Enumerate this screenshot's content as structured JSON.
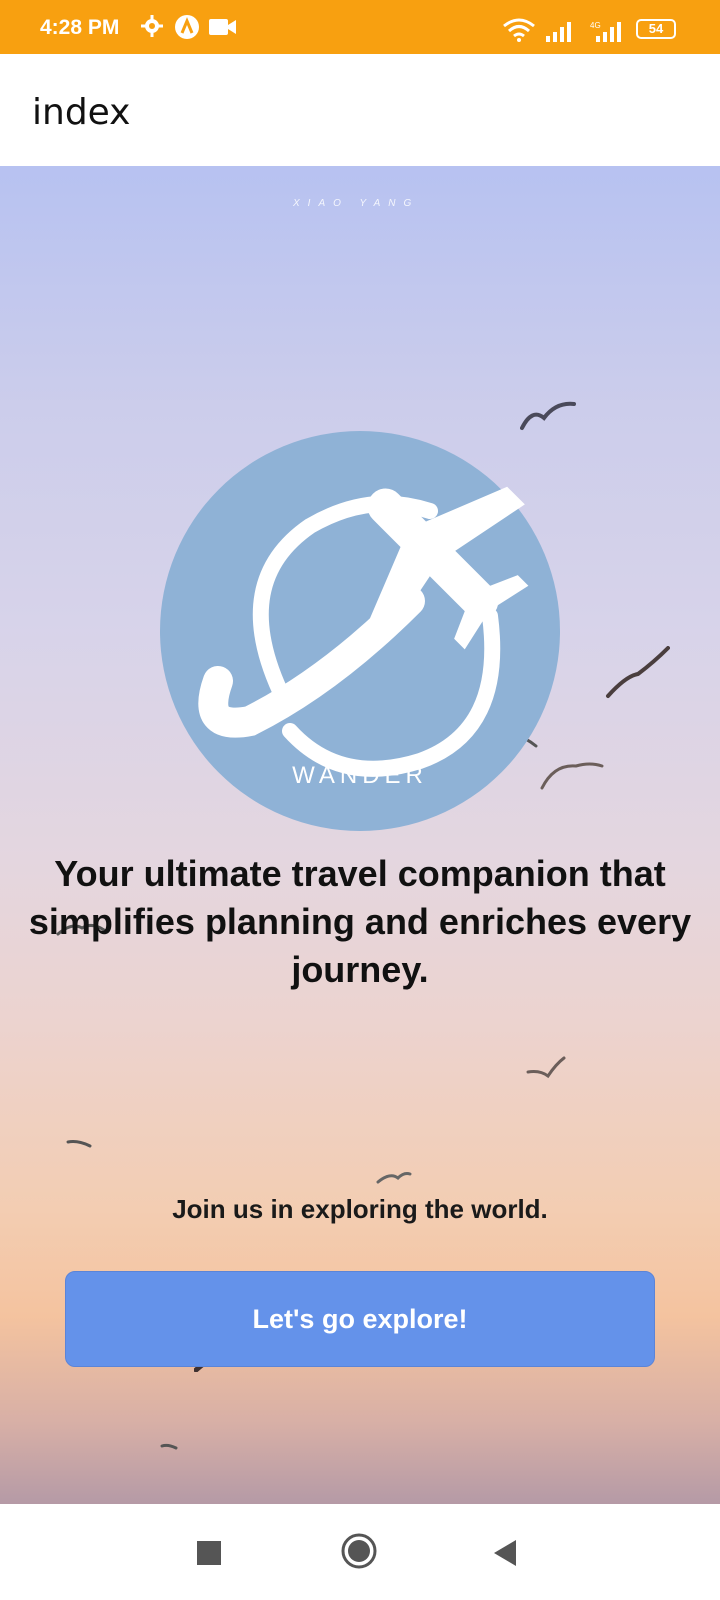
{
  "status_bar": {
    "time": "4:28 PM",
    "battery": "54",
    "background": "#f8a010"
  },
  "app_bar": {
    "title": "index"
  },
  "hero": {
    "watermark": "XIAO YANG",
    "logo_text": "WANDER",
    "tagline": "Your ultimate travel companion that simplifies planning and enriches every journey.",
    "join_text": "Join us in exploring the world.",
    "cta_label": "Let's go explore!"
  },
  "colors": {
    "logo_circle": "#8fb2d6",
    "button": "#6492ea"
  },
  "nav_bar": {
    "icons": [
      "recent-apps-icon",
      "home-icon",
      "back-icon"
    ]
  }
}
